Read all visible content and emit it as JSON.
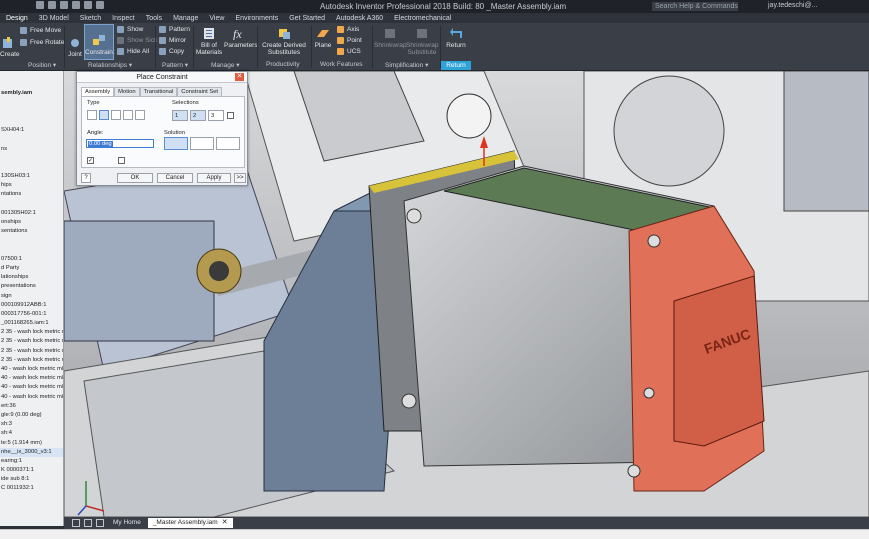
{
  "titlebar": {
    "title": "Autodesk Inventor Professional 2018 Build: 80   _Master Assembly.iam",
    "search_placeholder": "Search Help & Commands...",
    "user": "jay.tedeschi@..."
  },
  "menubar": [
    "Design",
    "3D Model",
    "Sketch",
    "Inspect",
    "Tools",
    "Manage",
    "View",
    "Environments",
    "Get Started",
    "Autodesk A360",
    "Electromechanical"
  ],
  "ribbon": {
    "create_label": "Create",
    "free_move": "Free Move",
    "free_rotate": "Free Rotate",
    "joint": "Joint",
    "constraint": "Constraint",
    "show": "Show",
    "show_sick": "Show Sick",
    "hide_all": "Hide All",
    "pattern": "Pattern",
    "mirror": "Mirror",
    "copy": "Copy",
    "bom": "Bill of Materials",
    "parameters": "Parameters",
    "create_derived": "Create Derived Substitutes",
    "plane": "Plane",
    "axis": "Axis",
    "point": "Point",
    "ucs": "UCS",
    "shrinkwrap": "Shrinkwrap",
    "shrinkwrap_sub": "Shrinkwrap Substitute",
    "return": "Return",
    "groups": {
      "position": "Position",
      "relationships": "Relationships",
      "pattern": "Pattern",
      "manage": "Manage",
      "productivity": "Productivity",
      "work_features": "Work Features",
      "simplification": "Simplification",
      "return": "Return"
    }
  },
  "browser": {
    "rows": [
      "",
      "",
      "sembly.iam",
      "",
      "",
      "",
      "SXH04:1",
      "",
      "ns",
      "",
      "",
      "130SH03:1",
      "hips",
      "ntations",
      "",
      "001305H02:1",
      "onships",
      "sentations",
      "",
      "",
      "07500:1",
      "d Party",
      "lationships",
      "presentations",
      "sign",
      "000109912ABB:1",
      "000317756-001:1",
      "_001168265.iam:1",
      "2 35 - wash lock metric m",
      "2 35 - wash lock metric m",
      "2 35 - wash lock metric m",
      "2 35 - wash lock metric m",
      "40 - wash lock metric m8",
      "40 - wash lock metric m8",
      "40 - wash lock metric m8",
      "40 - wash lock metric m8",
      "ert:36",
      "gle:9 (0.00 deg)",
      "sh:3",
      "sh:4",
      "te:5 (1.914 mm)",
      "nhe__ix_3000_v3:1",
      "earing:1",
      "K 0000371:1",
      "ide sub 8:1",
      "C 0011932:1"
    ]
  },
  "dialog": {
    "title": "Place Constraint",
    "tabs": [
      "Assembly",
      "Motion",
      "Transitional",
      "Constraint Set"
    ],
    "type_label": "Type",
    "selections_label": "Selections",
    "angle_label": "Angle:",
    "angle_value": "0.00 deg",
    "solution_label": "Solution",
    "ok": "OK",
    "cancel": "Cancel",
    "apply": "Apply",
    "more": ">>"
  },
  "tabs": {
    "home": "My Home",
    "doc": "_Master Assembly.iam"
  },
  "colors": {
    "accent": "#2ea3d8",
    "selection_red": "#e07058",
    "selection_green": "#5c7a54",
    "selection_yellow": "#d8c23a"
  }
}
